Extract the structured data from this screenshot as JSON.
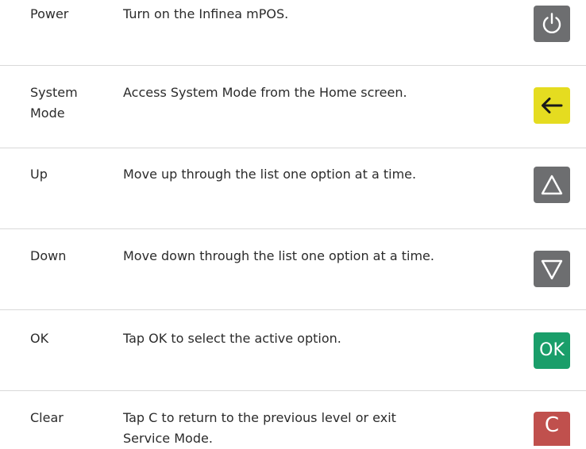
{
  "rows": [
    {
      "name": "Power",
      "desc": "Turn on the Infinea mPOS.",
      "key": {
        "icon": "power-icon",
        "color": "#6d6e70"
      }
    },
    {
      "name": "System Mode",
      "desc": "Access System Mode from the Home screen.",
      "key": {
        "icon": "left-arrow-icon",
        "color": "#e5dc20"
      }
    },
    {
      "name": "Up",
      "desc": "Move up through the list one option at a time.",
      "key": {
        "icon": "up-triangle-icon",
        "color": "#6d6e70"
      }
    },
    {
      "name": "Down",
      "desc": "Move down through the list one option at a time.",
      "key": {
        "icon": "down-triangle-icon",
        "color": "#6d6e70"
      }
    },
    {
      "name": "OK",
      "desc": "Tap OK to select the active option.",
      "key": {
        "label": "OK",
        "icon": "ok-key",
        "color": "#1a9e6a"
      }
    },
    {
      "name": "Clear",
      "desc": "Tap C to return to the previous level or exit Service Mode.",
      "key": {
        "label": "C",
        "icon": "clear-key",
        "color": "#c0504d"
      }
    }
  ]
}
